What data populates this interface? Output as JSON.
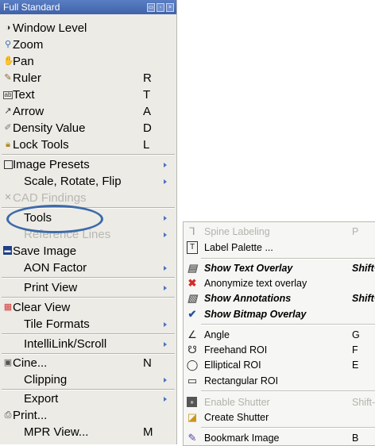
{
  "window": {
    "title": "Full Standard"
  },
  "menu": {
    "window_level": "Window Level",
    "zoom": "Zoom",
    "pan": "Pan",
    "ruler": "Ruler",
    "ruler_key": "R",
    "text": "Text",
    "text_key": "T",
    "arrow": "Arrow",
    "arrow_key": "A",
    "density": "Density Value",
    "density_key": "D",
    "lock": "Lock Tools",
    "lock_key": "L",
    "presets": "Image Presets",
    "scale": "Scale, Rotate, Flip",
    "cad": "CAD Findings",
    "tools": "Tools",
    "reference": "Reference Lines",
    "save": "Save Image",
    "aon": "AON Factor",
    "print_view": "Print View",
    "clear": "Clear View",
    "tile": "Tile Formats",
    "intellilink": "IntelliLink/Scroll",
    "cine": "Cine...",
    "cine_key": "N",
    "clipping": "Clipping",
    "export": "Export",
    "print": "Print...",
    "mpr": "MPR View...",
    "mpr_key": "M"
  },
  "submenu": {
    "spine": "Spine Labeling",
    "spine_key": "P",
    "label_palette": "Label Palette ...",
    "show_text": "Show Text Overlay",
    "show_text_key": "Shift+",
    "anonymize": "Anonymize text overlay",
    "show_annot": "Show Annotations",
    "show_annot_key": "Shift+",
    "show_bitmap": "Show Bitmap Overlay",
    "angle": "Angle",
    "angle_key": "G",
    "freehand": "Freehand ROI",
    "freehand_key": "F",
    "elliptical": "Elliptical ROI",
    "elliptical_key": "E",
    "rect": "Rectangular ROI",
    "enable_shutter": "Enable Shutter",
    "enable_shutter_key": "Shift-",
    "create_shutter": "Create Shutter",
    "bookmark": "Bookmark Image",
    "bookmark_key": "B"
  },
  "colors": {
    "title_bar": "#4a6db5",
    "submenu_arrow": "#4a73c3",
    "highlight_oval": "#3d6aa8"
  }
}
